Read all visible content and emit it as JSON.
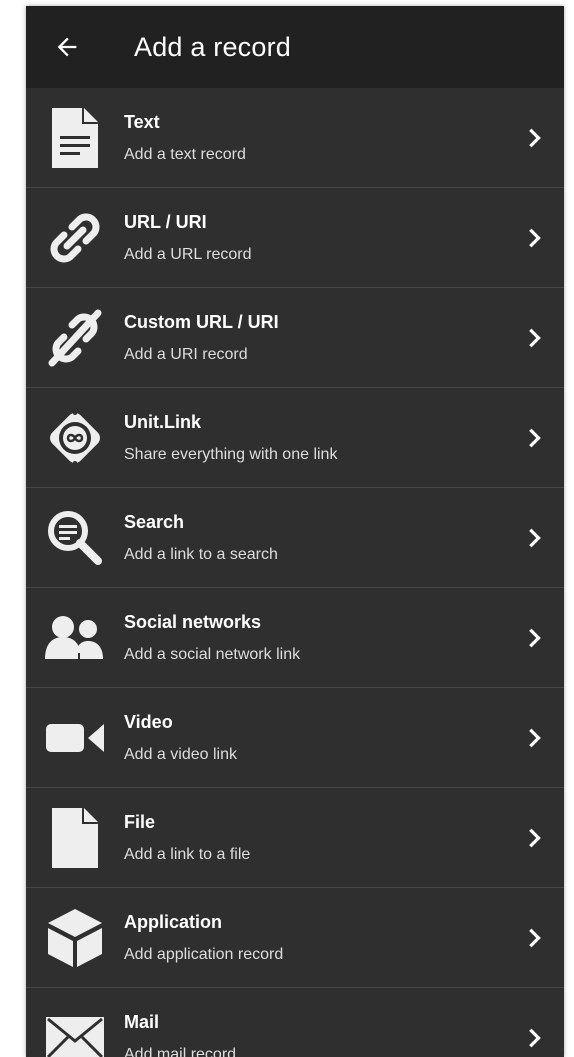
{
  "appbar": {
    "title": "Add a record"
  },
  "colors": {
    "background": "#2f2f2f",
    "appbar": "#212121",
    "divider": "#464646",
    "icon": "#eeeeee",
    "text": "#ffffff"
  },
  "records": [
    {
      "title": "Text",
      "subtitle": "Add a text record",
      "icon": "text-document-icon"
    },
    {
      "title": "URL / URI",
      "subtitle": "Add a URL record",
      "icon": "link-icon"
    },
    {
      "title": "Custom URL / URI",
      "subtitle": "Add a URI record",
      "icon": "custom-link-icon"
    },
    {
      "title": "Unit.Link",
      "subtitle": "Share everything with one link",
      "icon": "unit-link-logo-icon"
    },
    {
      "title": "Search",
      "subtitle": "Add a link to a search",
      "icon": "search-icon"
    },
    {
      "title": "Social networks",
      "subtitle": "Add a social network link",
      "icon": "people-icon"
    },
    {
      "title": "Video",
      "subtitle": "Add a video link",
      "icon": "video-camera-icon"
    },
    {
      "title": "File",
      "subtitle": "Add a link to a file",
      "icon": "file-icon"
    },
    {
      "title": "Application",
      "subtitle": "Add application record",
      "icon": "cube-icon"
    },
    {
      "title": "Mail",
      "subtitle": "Add mail record",
      "icon": "envelope-icon"
    }
  ]
}
